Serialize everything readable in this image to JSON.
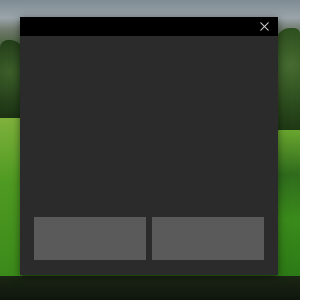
{
  "dialog": {
    "title": "",
    "close_icon": "close-icon",
    "body_text": "",
    "buttons": [
      {
        "label": ""
      },
      {
        "label": ""
      }
    ]
  },
  "colors": {
    "dialog_background": "#2b2b2b",
    "titlebar_background": "#000000",
    "button_background": "#5a5a5a",
    "close_icon": "#cfcfcf"
  }
}
